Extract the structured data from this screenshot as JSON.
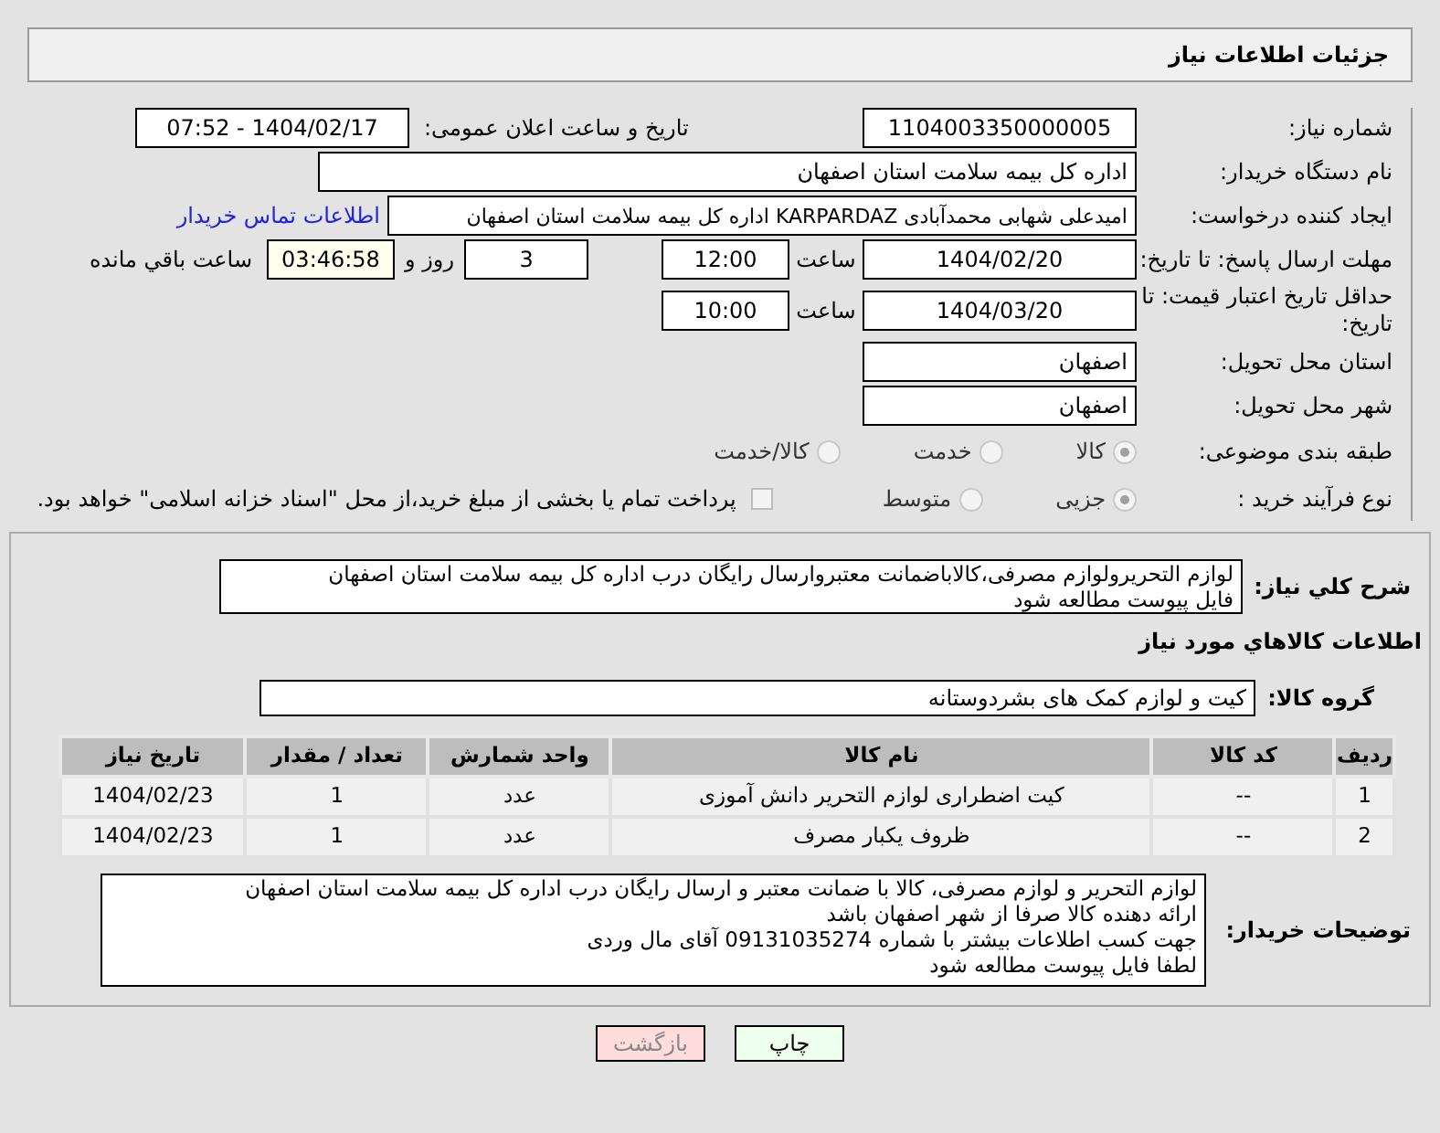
{
  "title": "جزئیات اطلاعات نیاز",
  "need_number": {
    "label": "شماره نیاز:",
    "value": "1104003350000005"
  },
  "announce": {
    "label": "تاریخ و ساعت اعلان عمومی:",
    "value": "1404/02/17 - 07:52"
  },
  "buyer_org": {
    "label": "نام دستگاه خریدار:",
    "value": "اداره کل بیمه سلامت استان اصفهان"
  },
  "requester": {
    "label": "ایجاد کننده درخواست:",
    "value": "امیدعلی شهابی محمدآبادی KARPARDAZ اداره کل بیمه سلامت استان اصفهان",
    "link": "اطلاعات تماس خریدار"
  },
  "deadline": {
    "label": "مهلت ارسال پاسخ: تا تاریخ:",
    "date": "1404/02/20",
    "time_label": "ساعت",
    "time": "12:00",
    "days": "3",
    "days_label": "روز و",
    "remaining": "03:46:58",
    "remaining_label": "ساعت باقي مانده"
  },
  "validity": {
    "label": "حداقل تاریخ اعتبار قیمت: تا تاریخ:",
    "date": "1404/03/20",
    "time_label": "ساعت",
    "time": "10:00"
  },
  "province": {
    "label": "استان محل تحویل:",
    "value": "اصفهان"
  },
  "city": {
    "label": "شهر محل تحویل:",
    "value": "اصفهان"
  },
  "category": {
    "label": "طبقه بندی موضوعی:",
    "options": [
      {
        "label": "کالا",
        "selected": true
      },
      {
        "label": "خدمت",
        "selected": false
      },
      {
        "label": "کالا/خدمت",
        "selected": false
      }
    ]
  },
  "process": {
    "label": "نوع فرآیند خرید :",
    "options": [
      {
        "label": "جزیی",
        "selected": true
      },
      {
        "label": "متوسط",
        "selected": false
      }
    ],
    "payment": {
      "label": "پرداخت تمام یا بخشی از مبلغ خرید،از محل \"اسناد خزانه اسلامی\" خواهد بود.",
      "checked": false
    }
  },
  "description": {
    "label": "شرح کلي نیاز:",
    "lines": [
      "لوازم التحریرولوازم مصرفی،کالاباضمانت معتبروارسال رایگان درب اداره کل بیمه سلامت استان اصفهان",
      "فایل پیوست مطالعه شود"
    ]
  },
  "goods_header": "اطلاعات کالاهاي مورد نیاز",
  "group": {
    "label": "گروه کالا:",
    "value": "کیت و لوازم کمک های بشردوستانه"
  },
  "table": {
    "columns": [
      "ردیف",
      "کد کالا",
      "نام کالا",
      "واحد شمارش",
      "تعداد / مقدار",
      "تاریخ نیاز"
    ],
    "rows": [
      [
        "1",
        "--",
        "کیت اضطراری لوازم التحریر دانش آموزی",
        "عدد",
        "1",
        "1404/02/23"
      ],
      [
        "2",
        "--",
        "ظروف یکبار مصرف",
        "عدد",
        "1",
        "1404/02/23"
      ]
    ]
  },
  "notes": {
    "label": "توضیحات خریدار:",
    "lines": [
      "لوازم التحریر و لوازم مصرفی، کالا با ضمانت معتبر و ارسال رایگان درب اداره کل بیمه سلامت استان اصفهان",
      "ارائه دهنده کالا صرفا از شهر اصفهان باشد",
      "جهت کسب اطلاعات بیشتر با شماره 09131035274 آقای مال وردی",
      "لطفا فایل پیوست مطالعه شود"
    ]
  },
  "buttons": [
    {
      "label": "چاپ",
      "kind": "print"
    },
    {
      "label": "بازگشت",
      "kind": "back"
    }
  ]
}
